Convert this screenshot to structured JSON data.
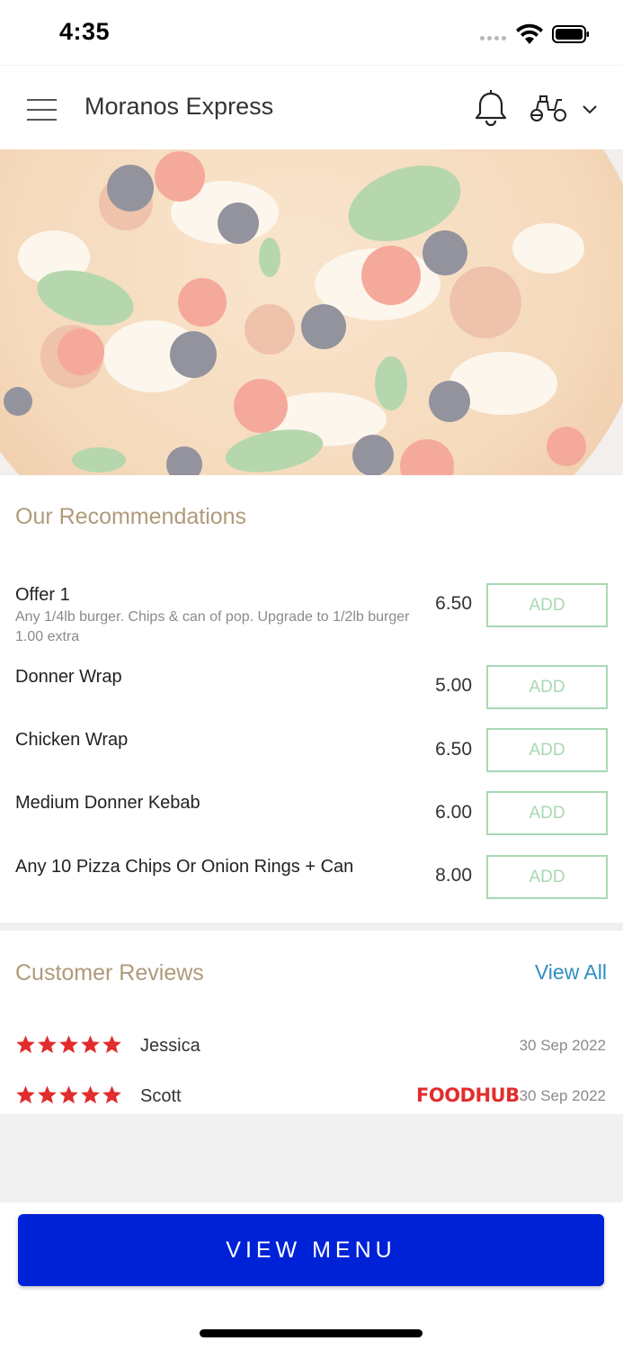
{
  "status_bar": {
    "time": "4:35",
    "icons": [
      "signal-dots-icon",
      "wifi-icon",
      "battery-icon"
    ]
  },
  "header": {
    "title": "Moranos Express",
    "icons": [
      "menu-icon",
      "bell-icon",
      "delivery-scooter-icon",
      "chevron-down-icon"
    ]
  },
  "hero": {
    "image": "pizza-photo"
  },
  "recommendations": {
    "title": "Our Recommendations",
    "items": [
      {
        "name": "Offer 1",
        "description": "Any 1/4lb burger. Chips & can of pop. Upgrade to 1/2lb burger 1.00 extra",
        "price": "6.50",
        "button": "ADD"
      },
      {
        "name": "Donner Wrap",
        "description": "",
        "price": "5.00",
        "button": "ADD"
      },
      {
        "name": "Chicken Wrap",
        "description": "",
        "price": "6.50",
        "button": "ADD"
      },
      {
        "name": "Medium Donner Kebab",
        "description": "",
        "price": "6.00",
        "button": "ADD"
      },
      {
        "name": "Any 10 Pizza Chips Or Onion Rings + Can",
        "description": "",
        "price": "8.00",
        "button": "ADD"
      }
    ]
  },
  "reviews": {
    "title": "Customer Reviews",
    "view_all": "View All",
    "items": [
      {
        "name": "Jessica",
        "rating": 5,
        "date": "30 Sep 2022",
        "source": ""
      },
      {
        "name": "Scott",
        "rating": 5,
        "date": "30 Sep 2022",
        "source": "FOODHUB"
      }
    ]
  },
  "footer": {
    "button": "VIEW MENU"
  },
  "colors": {
    "accent_title": "#b09a7a",
    "add_button": "#a8d8b3",
    "link": "#2f8fc0",
    "star": "#e12d2d",
    "primary_button": "#0022d6"
  }
}
